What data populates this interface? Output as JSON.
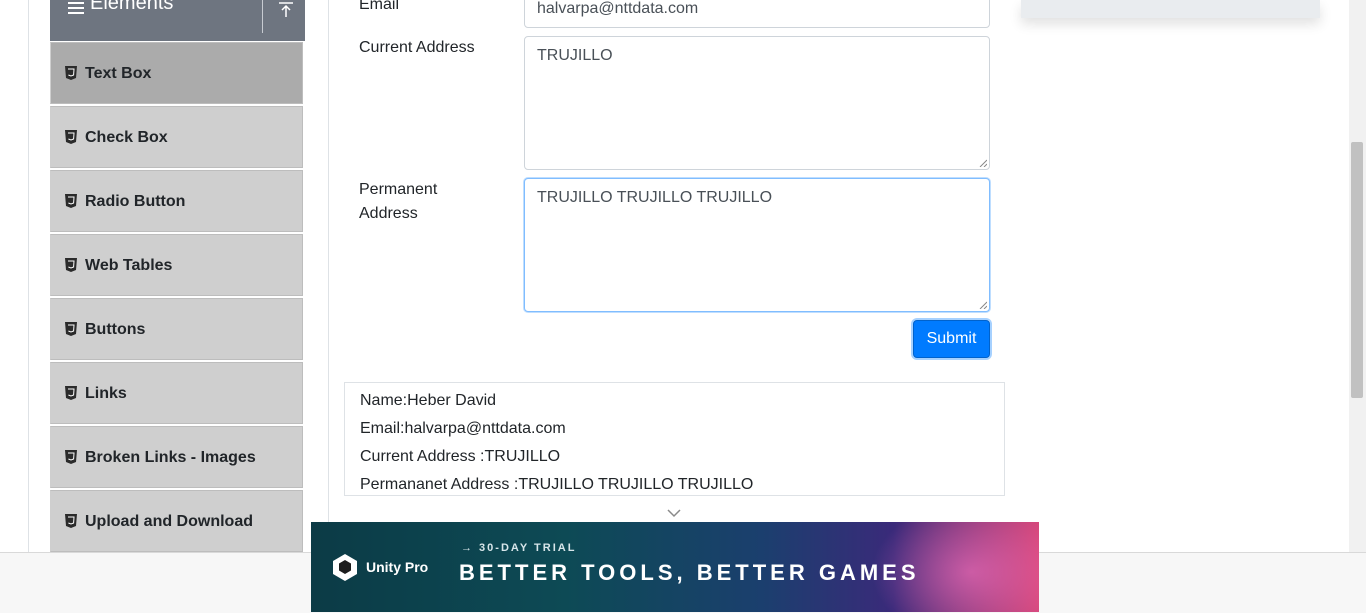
{
  "sidebar": {
    "group_title": "Elements",
    "items": [
      {
        "label": "Text Box",
        "active": true
      },
      {
        "label": "Check Box"
      },
      {
        "label": "Radio Button"
      },
      {
        "label": "Web Tables"
      },
      {
        "label": "Buttons"
      },
      {
        "label": "Links"
      },
      {
        "label": "Broken Links - Images"
      },
      {
        "label": "Upload and Download"
      }
    ]
  },
  "form": {
    "email_label": "Email",
    "email_value": "halvarpa@nttdata.com",
    "current_address_label": "Current Address",
    "current_address_value": "TRUJILLO",
    "permanent_address_label_1": "Permanent",
    "permanent_address_label_2": "Address",
    "permanent_address_value": "TRUJILLO TRUJILLO TRUJILLO",
    "submit_label": "Submit"
  },
  "output": {
    "name": "Name:Heber David",
    "email": "Email:halvarpa@nttdata.com",
    "current_address": "Current Address :TRUJILLO",
    "permanent_address": "Permananet Address :TRUJILLO TRUJILLO TRUJILLO"
  },
  "ad": {
    "brand": "Unity Pro",
    "trial": "→ 30-DAY TRIAL",
    "headline": "BETTER TOOLS, BETTER GAMES"
  },
  "colors": {
    "primary": "#007bff",
    "sidebar_item": "#cfcfcf",
    "sidebar_active": "#ababab",
    "group_header": "#6e7580"
  }
}
